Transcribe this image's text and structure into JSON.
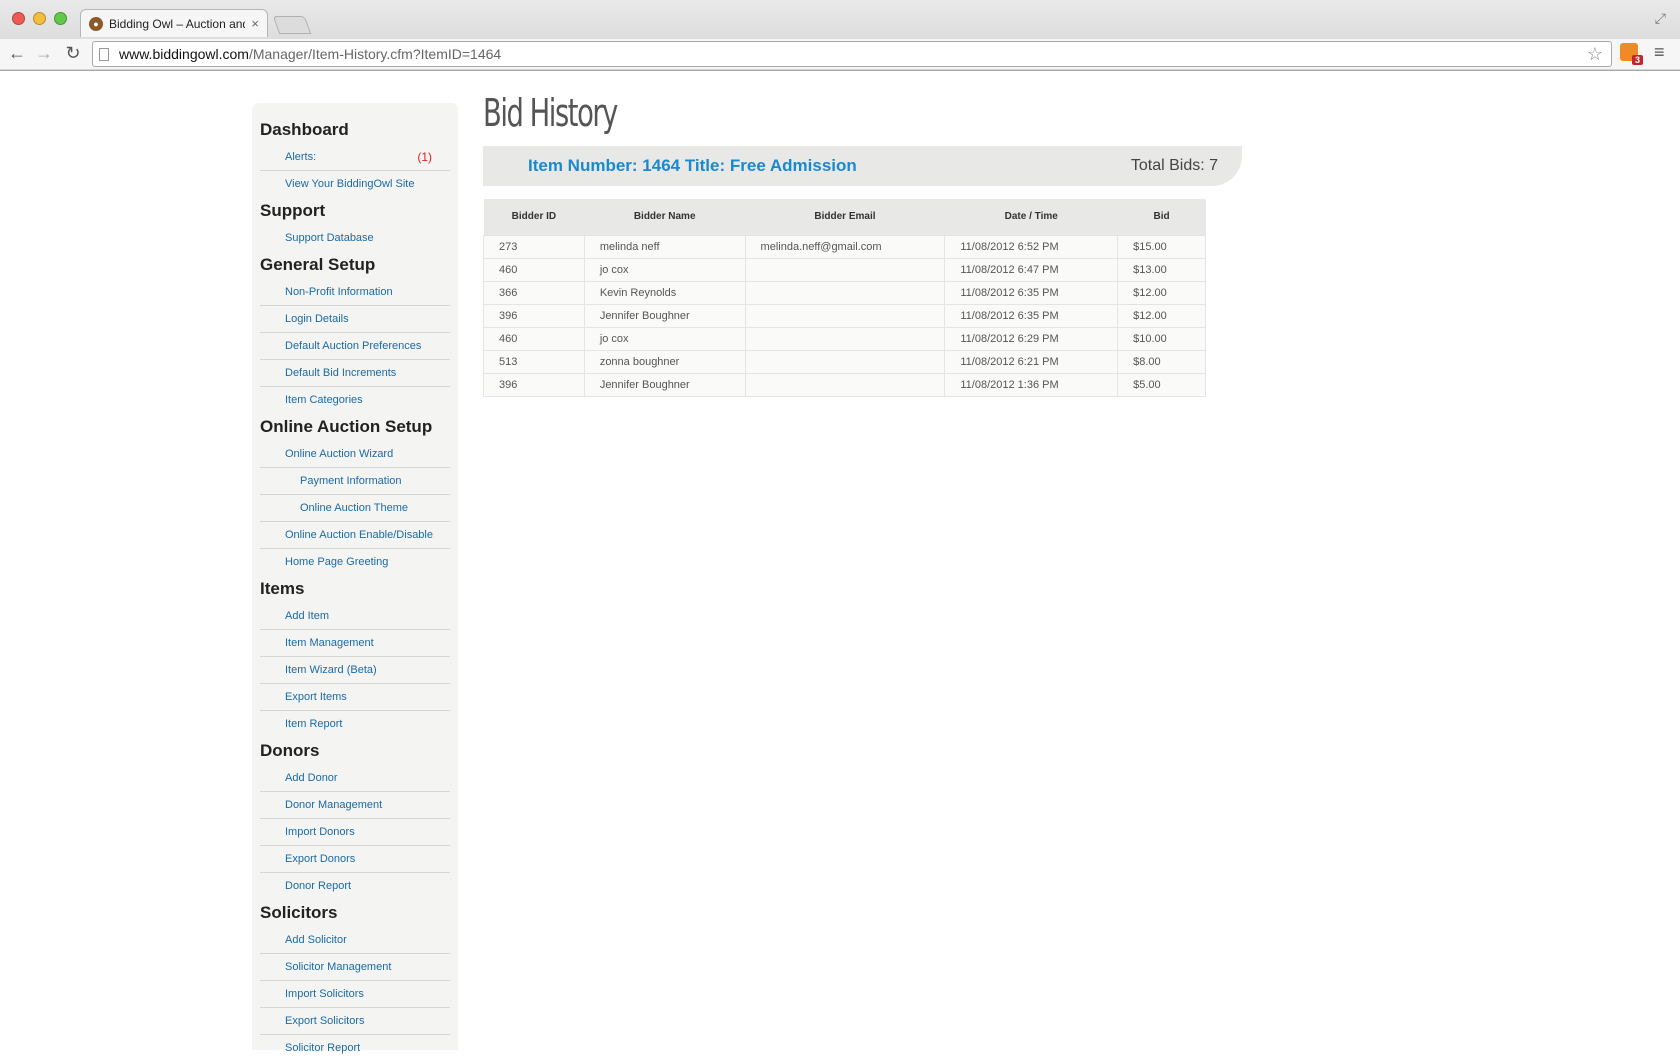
{
  "browser": {
    "tab_title": "Bidding Owl – Auction and",
    "tab_close": "×",
    "url_host": "www.biddingowl.com",
    "url_path": "/Manager/Item-History.cfm?ItemID=1464",
    "rss_badge": "3",
    "colors": {
      "close": "#ee5b54",
      "minimize": "#f5bd3a",
      "zoom": "#5fc948"
    },
    "icons": [
      "back-arrow-icon",
      "forward-arrow-icon",
      "reload-icon",
      "page-icon",
      "star-icon",
      "rss-icon",
      "menu-icon",
      "fullscreen-icon"
    ]
  },
  "sidebar": {
    "sections": [
      {
        "title": "Dashboard",
        "items": [
          {
            "label": "Alerts:",
            "count": "(1)"
          },
          {
            "label": "View Your BiddingOwl Site"
          }
        ]
      },
      {
        "title": "Support",
        "items": [
          {
            "label": "Support Database"
          }
        ]
      },
      {
        "title": "General Setup",
        "items": [
          {
            "label": "Non-Profit Information"
          },
          {
            "label": "Login Details"
          },
          {
            "label": "Default Auction Preferences"
          },
          {
            "label": "Default Bid Increments"
          },
          {
            "label": "Item Categories"
          }
        ]
      },
      {
        "title": "Online Auction Setup",
        "items": [
          {
            "label": "Online Auction Wizard"
          },
          {
            "label": "Payment Information",
            "sub": true
          },
          {
            "label": "Online Auction Theme",
            "sub": true
          },
          {
            "label": "Online Auction Enable/Disable"
          },
          {
            "label": "Home Page Greeting"
          }
        ]
      },
      {
        "title": "Items",
        "items": [
          {
            "label": "Add Item"
          },
          {
            "label": "Item Management"
          },
          {
            "label": "Item Wizard (Beta)"
          },
          {
            "label": "Export Items"
          },
          {
            "label": "Item Report"
          }
        ]
      },
      {
        "title": "Donors",
        "items": [
          {
            "label": "Add Donor"
          },
          {
            "label": "Donor Management"
          },
          {
            "label": "Import Donors"
          },
          {
            "label": "Export Donors"
          },
          {
            "label": "Donor Report"
          }
        ]
      },
      {
        "title": "Solicitors",
        "items": [
          {
            "label": "Add Solicitor"
          },
          {
            "label": "Solicitor Management"
          },
          {
            "label": "Import Solicitors"
          },
          {
            "label": "Export Solicitors"
          },
          {
            "label": "Solicitor Report"
          }
        ]
      }
    ]
  },
  "main": {
    "title": "Bid History",
    "item_info": "Item Number: 1464 Title: Free Admission",
    "total_bids": "Total Bids: 7",
    "table": {
      "headers": [
        "Bidder ID",
        "Bidder Name",
        "Bidder Email",
        "Date / Time",
        "Bid"
      ],
      "rows": [
        [
          "273",
          "melinda neff",
          "melinda.neff@gmail.com",
          "11/08/2012 6:52 PM",
          "$15.00"
        ],
        [
          "460",
          "jo cox",
          "",
          "11/08/2012 6:47 PM",
          "$13.00"
        ],
        [
          "366",
          "Kevin Reynolds",
          "",
          "11/08/2012 6:35 PM",
          "$12.00"
        ],
        [
          "396",
          "Jennifer Boughner",
          "",
          "11/08/2012 6:35 PM",
          "$12.00"
        ],
        [
          "460",
          "jo cox",
          "",
          "11/08/2012 6:29 PM",
          "$10.00"
        ],
        [
          "513",
          "zonna boughner",
          "",
          "11/08/2012 6:21 PM",
          "$8.00"
        ],
        [
          "396",
          "Jennifer Boughner",
          "",
          "11/08/2012 1:36 PM",
          "$5.00"
        ]
      ]
    }
  }
}
